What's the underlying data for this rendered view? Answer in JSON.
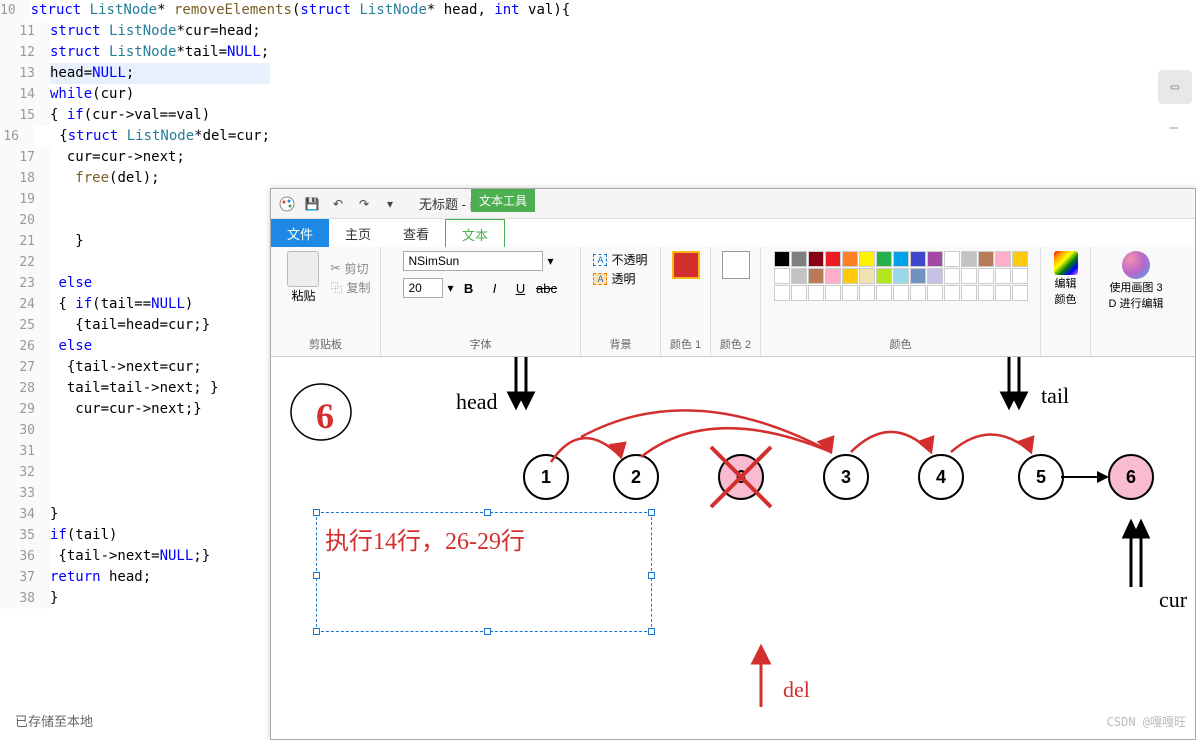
{
  "editor": {
    "lines": [
      {
        "n": 10,
        "html": "struct ListNode* removeElements(struct ListNode* head, int val){"
      },
      {
        "n": 11,
        "html": "struct ListNode*cur=head;"
      },
      {
        "n": 12,
        "html": "struct ListNode*tail=NULL;"
      },
      {
        "n": 13,
        "html": "head=NULL;"
      },
      {
        "n": 14,
        "html": "while(cur)"
      },
      {
        "n": 15,
        "html": "{ if(cur->val==val)"
      },
      {
        "n": 16,
        "html": "   {struct ListNode*del=cur;"
      },
      {
        "n": 17,
        "html": "  cur=cur->next;"
      },
      {
        "n": 18,
        "html": "   free(del);"
      },
      {
        "n": 19,
        "html": ""
      },
      {
        "n": 20,
        "html": ""
      },
      {
        "n": 21,
        "html": "   }"
      },
      {
        "n": 22,
        "html": ""
      },
      {
        "n": 23,
        "html": " else"
      },
      {
        "n": 24,
        "html": " { if(tail==NULL)"
      },
      {
        "n": 25,
        "html": "   {tail=head=cur;}"
      },
      {
        "n": 26,
        "html": " else"
      },
      {
        "n": 27,
        "html": "  {tail->next=cur;"
      },
      {
        "n": 28,
        "html": "  tail=tail->next; }"
      },
      {
        "n": 29,
        "html": "   cur=cur->next;}"
      },
      {
        "n": 30,
        "html": ""
      },
      {
        "n": 31,
        "html": ""
      },
      {
        "n": 32,
        "html": ""
      },
      {
        "n": 33,
        "html": ""
      },
      {
        "n": 34,
        "html": "}"
      },
      {
        "n": 35,
        "html": "if(tail)"
      },
      {
        "n": 36,
        "html": " {tail->next=NULL;}"
      },
      {
        "n": 37,
        "html": "return head;"
      },
      {
        "n": 38,
        "html": "}"
      }
    ],
    "status": "已存储至本地",
    "highlight_line": 13
  },
  "paint": {
    "title": "无标题 - 画图",
    "text_tool_tag": "文本工具",
    "tabs": {
      "file": "文件",
      "home": "主页",
      "view": "查看",
      "text": "文本"
    },
    "clipboard": {
      "paste": "粘贴",
      "cut": "剪切",
      "copy": "复制",
      "label": "剪贴板"
    },
    "font": {
      "name": "NSimSun",
      "size": "20",
      "bold": "B",
      "italic": "I",
      "underline": "U",
      "strike": "abc",
      "label": "字体"
    },
    "background": {
      "opaque": "不透明",
      "transparent": "透明",
      "label": "背景"
    },
    "color1": "颜色 1",
    "color2": "颜色 2",
    "colors_label": "颜色",
    "edit_colors": "编辑\n颜色",
    "paint3d": "使用画图 3\nD 进行编辑",
    "canvas": {
      "head_label": "head",
      "tail_label": "tail",
      "cur_label": "cur",
      "del_label": "del",
      "big_six": "6",
      "nodes": [
        "1",
        "2",
        "6",
        "3",
        "4",
        "5",
        "6"
      ],
      "text_box": "执行14行，26-29行"
    }
  },
  "palette_colors": [
    "#000000",
    "#7f7f7f",
    "#880015",
    "#ed1c24",
    "#ff7f27",
    "#fff200",
    "#22b14c",
    "#00a2e8",
    "#3f48cc",
    "#a349a4",
    "#ffffff",
    "#c3c3c3",
    "#b97a57",
    "#ffaec9",
    "#ffc90e",
    "#ffffff",
    "#c3c3c3",
    "#b97a57",
    "#ffaec9",
    "#ffc90e",
    "#efe4b0",
    "#b5e61d",
    "#99d9ea",
    "#7092be",
    "#c8bfe7",
    "#ffffff",
    "#ffffff",
    "#ffffff",
    "#ffffff",
    "#ffffff",
    "#ffffff",
    "#ffffff",
    "#ffffff",
    "#ffffff",
    "#ffffff",
    "#ffffff",
    "#ffffff",
    "#ffffff",
    "#ffffff",
    "#ffffff",
    "#ffffff",
    "#ffffff",
    "#ffffff",
    "#ffffff",
    "#ffffff"
  ],
  "watermark": "CSDN @嘎嘎旺"
}
